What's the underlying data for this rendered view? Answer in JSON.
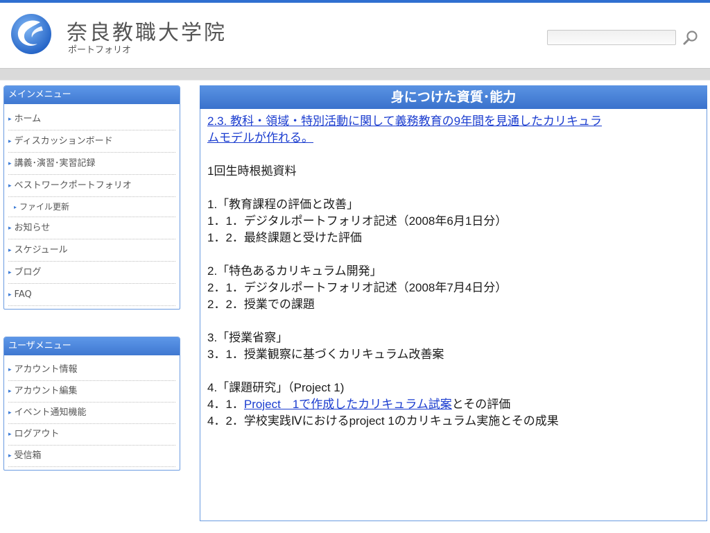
{
  "header": {
    "title": "奈良教職大学院",
    "subtitle": "ポートフォリオ",
    "search": {
      "value": "",
      "placeholder": ""
    },
    "search_icon": "search-icon",
    "colors": {
      "accent": "#3a72cc",
      "menu_border": "#6b9be0",
      "link": "#1a3ccf"
    }
  },
  "main_menu": {
    "title": "メインメニュー",
    "items": [
      {
        "label": "ホーム"
      },
      {
        "label": "ディスカッションボード"
      },
      {
        "label": "講義･演習･実習記録"
      },
      {
        "label": "ベストワークポートフォリオ"
      },
      {
        "label": "ファイル更新"
      },
      {
        "label": "お知らせ"
      },
      {
        "label": "スケジュール"
      },
      {
        "label": "ブログ"
      },
      {
        "label": "FAQ"
      }
    ]
  },
  "user_menu": {
    "title": "ユーザメニュー",
    "items": [
      {
        "label": "アカウント情報"
      },
      {
        "label": "アカウント編集"
      },
      {
        "label": "イベント通知機能"
      },
      {
        "label": "ログアウト"
      },
      {
        "label": "受信箱"
      }
    ]
  },
  "content": {
    "title": "身につけた資質･能力",
    "heading_link_1": "2.3.  教科・領域・特別活動に関して義務教育の9年間を見通したカリキュラ",
    "heading_link_2": "ムモデルが作れる。",
    "intro": "1回生時根拠資料",
    "s1": "1.「教育課程の評価と改善」",
    "s1_1": "1．1．デジタルポートフォリオ記述（2008年6月1日分）",
    "s1_2": "1．2．最終課題と受けた評価",
    "s2": "2.「特色あるカリキュラム開発」",
    "s2_1": "2．1．デジタルポートフォリオ記述（2008年7月4日分）",
    "s2_2": "2．2．授業での課題",
    "s3": "3.「授業省察」",
    "s3_1": "3．1．授業観察に基づくカリキュラム改善案",
    "s4": "4.「課題研究」（Project 1)",
    "s4_1_prefix": "4．1．",
    "s4_1_link": "Project　1で作成したカリキュラム試案",
    "s4_1_suffix": "とその評価",
    "s4_2": "4．2．学校実践Ⅳにおけるproject 1のカリキュラム実施とその成果"
  }
}
